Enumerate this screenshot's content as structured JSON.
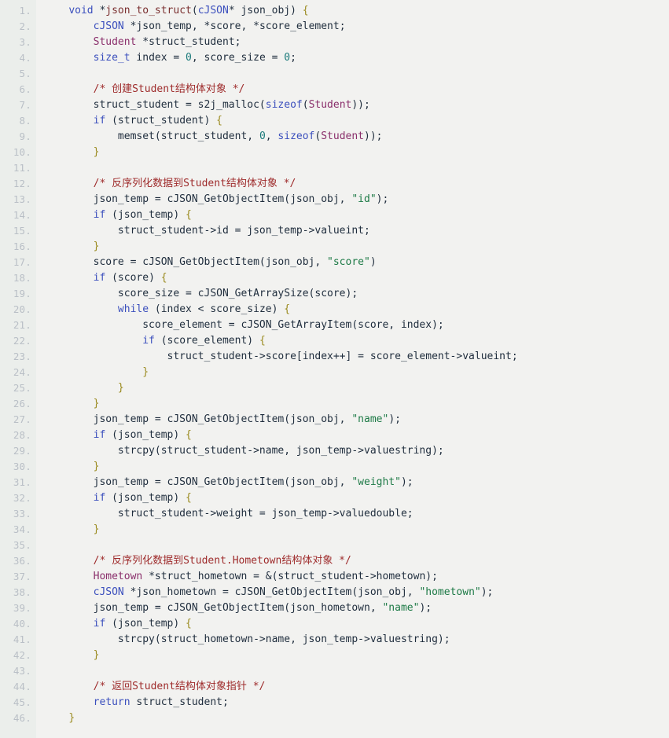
{
  "editor": {
    "language": "c",
    "line_count": 46,
    "colors": {
      "background": "#f2f2f0",
      "gutter_background": "#ebeeeb",
      "line_number": "#b9bfc6",
      "keyword": "#3b4fbd",
      "type": "#8a2f6b",
      "function": "#7a2f2f",
      "comment": "#9e2b2b",
      "string": "#1d7a46",
      "number": "#1a7a7a",
      "brace": "#9a8a1e",
      "identifier": "#1f2d3d"
    },
    "line_numbers": [
      "1.",
      "2.",
      "3.",
      "4.",
      "5.",
      "6.",
      "7.",
      "8.",
      "9.",
      "10.",
      "11.",
      "12.",
      "13.",
      "14.",
      "15.",
      "16.",
      "17.",
      "18.",
      "19.",
      "20.",
      "21.",
      "22.",
      "23.",
      "24.",
      "25.",
      "26.",
      "27.",
      "28.",
      "29.",
      "30.",
      "31.",
      "32.",
      "33.",
      "34.",
      "35.",
      "36.",
      "37.",
      "38.",
      "39.",
      "40.",
      "41.",
      "42.",
      "43.",
      "44.",
      "45.",
      "46."
    ],
    "lines": [
      [
        {
          "t": "    ",
          "c": "plain"
        },
        {
          "t": "void",
          "c": "kw"
        },
        {
          "t": " *",
          "c": "plain"
        },
        {
          "t": "json_to_struct",
          "c": "fn"
        },
        {
          "t": "(",
          "c": "plain"
        },
        {
          "t": "cJSON",
          "c": "kw"
        },
        {
          "t": "* json_obj) ",
          "c": "plain"
        },
        {
          "t": "{",
          "c": "brace"
        }
      ],
      [
        {
          "t": "        ",
          "c": "plain"
        },
        {
          "t": "cJSON",
          "c": "kw"
        },
        {
          "t": " *json_temp, *score, *score_element;",
          "c": "plain"
        }
      ],
      [
        {
          "t": "        ",
          "c": "plain"
        },
        {
          "t": "Student",
          "c": "type"
        },
        {
          "t": " *struct_student;",
          "c": "plain"
        }
      ],
      [
        {
          "t": "        ",
          "c": "plain"
        },
        {
          "t": "size_t",
          "c": "kw"
        },
        {
          "t": " index = ",
          "c": "plain"
        },
        {
          "t": "0",
          "c": "num"
        },
        {
          "t": ", score_size = ",
          "c": "plain"
        },
        {
          "t": "0",
          "c": "num"
        },
        {
          "t": ";",
          "c": "plain"
        }
      ],
      [
        {
          "t": "",
          "c": "plain"
        }
      ],
      [
        {
          "t": "        ",
          "c": "plain"
        },
        {
          "t": "/* 创建Student结构体对象 */",
          "c": "cmt"
        }
      ],
      [
        {
          "t": "        struct_student = s2j_malloc(",
          "c": "plain"
        },
        {
          "t": "sizeof",
          "c": "kw"
        },
        {
          "t": "(",
          "c": "plain"
        },
        {
          "t": "Student",
          "c": "type"
        },
        {
          "t": "));",
          "c": "plain"
        }
      ],
      [
        {
          "t": "        ",
          "c": "plain"
        },
        {
          "t": "if",
          "c": "kw"
        },
        {
          "t": " (struct_student) ",
          "c": "plain"
        },
        {
          "t": "{",
          "c": "brace"
        }
      ],
      [
        {
          "t": "            memset(struct_student, ",
          "c": "plain"
        },
        {
          "t": "0",
          "c": "num"
        },
        {
          "t": ", ",
          "c": "plain"
        },
        {
          "t": "sizeof",
          "c": "kw"
        },
        {
          "t": "(",
          "c": "plain"
        },
        {
          "t": "Student",
          "c": "type"
        },
        {
          "t": "));",
          "c": "plain"
        }
      ],
      [
        {
          "t": "        ",
          "c": "plain"
        },
        {
          "t": "}",
          "c": "brace"
        }
      ],
      [
        {
          "t": "",
          "c": "plain"
        }
      ],
      [
        {
          "t": "        ",
          "c": "plain"
        },
        {
          "t": "/* 反序列化数据到Student结构体对象 */",
          "c": "cmt"
        }
      ],
      [
        {
          "t": "        json_temp = cJSON_GetObjectItem(json_obj, ",
          "c": "plain"
        },
        {
          "t": "\"id\"",
          "c": "str"
        },
        {
          "t": ");",
          "c": "plain"
        }
      ],
      [
        {
          "t": "        ",
          "c": "plain"
        },
        {
          "t": "if",
          "c": "kw"
        },
        {
          "t": " (json_temp) ",
          "c": "plain"
        },
        {
          "t": "{",
          "c": "brace"
        }
      ],
      [
        {
          "t": "            struct_student->id = json_temp->valueint;",
          "c": "plain"
        }
      ],
      [
        {
          "t": "        ",
          "c": "plain"
        },
        {
          "t": "}",
          "c": "brace"
        }
      ],
      [
        {
          "t": "        score = cJSON_GetObjectItem(json_obj, ",
          "c": "plain"
        },
        {
          "t": "\"score\"",
          "c": "str"
        },
        {
          "t": ")",
          "c": "plain"
        }
      ],
      [
        {
          "t": "        ",
          "c": "plain"
        },
        {
          "t": "if",
          "c": "kw"
        },
        {
          "t": " (score) ",
          "c": "plain"
        },
        {
          "t": "{",
          "c": "brace"
        }
      ],
      [
        {
          "t": "            score_size = cJSON_GetArraySize(score);",
          "c": "plain"
        }
      ],
      [
        {
          "t": "            ",
          "c": "plain"
        },
        {
          "t": "while",
          "c": "kw"
        },
        {
          "t": " (index < score_size) ",
          "c": "plain"
        },
        {
          "t": "{",
          "c": "brace"
        }
      ],
      [
        {
          "t": "                score_element = cJSON_GetArrayItem(score, index);",
          "c": "plain"
        }
      ],
      [
        {
          "t": "                ",
          "c": "plain"
        },
        {
          "t": "if",
          "c": "kw"
        },
        {
          "t": " (score_element) ",
          "c": "plain"
        },
        {
          "t": "{",
          "c": "brace"
        }
      ],
      [
        {
          "t": "                    struct_student->score[index++] = score_element->valueint;",
          "c": "plain"
        }
      ],
      [
        {
          "t": "                ",
          "c": "plain"
        },
        {
          "t": "}",
          "c": "brace"
        }
      ],
      [
        {
          "t": "            ",
          "c": "plain"
        },
        {
          "t": "}",
          "c": "brace"
        }
      ],
      [
        {
          "t": "        ",
          "c": "plain"
        },
        {
          "t": "}",
          "c": "brace"
        }
      ],
      [
        {
          "t": "        json_temp = cJSON_GetObjectItem(json_obj, ",
          "c": "plain"
        },
        {
          "t": "\"name\"",
          "c": "str"
        },
        {
          "t": ");",
          "c": "plain"
        }
      ],
      [
        {
          "t": "        ",
          "c": "plain"
        },
        {
          "t": "if",
          "c": "kw"
        },
        {
          "t": " (json_temp) ",
          "c": "plain"
        },
        {
          "t": "{",
          "c": "brace"
        }
      ],
      [
        {
          "t": "            strcpy(struct_student->name, json_temp->valuestring);",
          "c": "plain"
        }
      ],
      [
        {
          "t": "        ",
          "c": "plain"
        },
        {
          "t": "}",
          "c": "brace"
        }
      ],
      [
        {
          "t": "        json_temp = cJSON_GetObjectItem(json_obj, ",
          "c": "plain"
        },
        {
          "t": "\"weight\"",
          "c": "str"
        },
        {
          "t": ");",
          "c": "plain"
        }
      ],
      [
        {
          "t": "        ",
          "c": "plain"
        },
        {
          "t": "if",
          "c": "kw"
        },
        {
          "t": " (json_temp) ",
          "c": "plain"
        },
        {
          "t": "{",
          "c": "brace"
        }
      ],
      [
        {
          "t": "            struct_student->weight = json_temp->valuedouble;",
          "c": "plain"
        }
      ],
      [
        {
          "t": "        ",
          "c": "plain"
        },
        {
          "t": "}",
          "c": "brace"
        }
      ],
      [
        {
          "t": "",
          "c": "plain"
        }
      ],
      [
        {
          "t": "        ",
          "c": "plain"
        },
        {
          "t": "/* 反序列化数据到Student.Hometown结构体对象 */",
          "c": "cmt"
        }
      ],
      [
        {
          "t": "        ",
          "c": "plain"
        },
        {
          "t": "Hometown",
          "c": "type"
        },
        {
          "t": " *struct_hometown = &(struct_student->hometown);",
          "c": "plain"
        }
      ],
      [
        {
          "t": "        ",
          "c": "plain"
        },
        {
          "t": "cJSON",
          "c": "kw"
        },
        {
          "t": " *json_hometown = cJSON_GetObjectItem(json_obj, ",
          "c": "plain"
        },
        {
          "t": "\"hometown\"",
          "c": "str"
        },
        {
          "t": ");",
          "c": "plain"
        }
      ],
      [
        {
          "t": "        json_temp = cJSON_GetObjectItem(json_hometown, ",
          "c": "plain"
        },
        {
          "t": "\"name\"",
          "c": "str"
        },
        {
          "t": ");",
          "c": "plain"
        }
      ],
      [
        {
          "t": "        ",
          "c": "plain"
        },
        {
          "t": "if",
          "c": "kw"
        },
        {
          "t": " (json_temp) ",
          "c": "plain"
        },
        {
          "t": "{",
          "c": "brace"
        }
      ],
      [
        {
          "t": "            strcpy(struct_hometown->name, json_temp->valuestring);",
          "c": "plain"
        }
      ],
      [
        {
          "t": "        ",
          "c": "plain"
        },
        {
          "t": "}",
          "c": "brace"
        }
      ],
      [
        {
          "t": "",
          "c": "plain"
        }
      ],
      [
        {
          "t": "        ",
          "c": "plain"
        },
        {
          "t": "/* 返回Student结构体对象指针 */",
          "c": "cmt"
        }
      ],
      [
        {
          "t": "        ",
          "c": "plain"
        },
        {
          "t": "return",
          "c": "kw"
        },
        {
          "t": " struct_student;",
          "c": "plain"
        }
      ],
      [
        {
          "t": "    ",
          "c": "plain"
        },
        {
          "t": "}",
          "c": "brace"
        }
      ]
    ]
  }
}
